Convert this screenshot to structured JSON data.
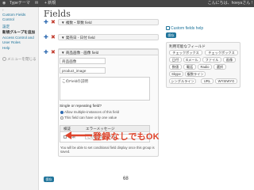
{
  "adminbar": {
    "site": "Typeテーマ",
    "comments": "0",
    "new": "+ 新規",
    "howdy": "こんにちは、hoeyaさん !"
  },
  "sidebar": {
    "items": [
      {
        "label": "Custom Fields"
      },
      {
        "label": "Control"
      },
      {
        "label": "設定"
      },
      {
        "label": "新規グループを追加"
      },
      {
        "label": "Access Control and"
      },
      {
        "label": "User Roles"
      },
      {
        "label": "Help"
      }
    ],
    "collapse": "メニューを閉じる"
  },
  "page": {
    "title": "Fields",
    "page_number": "68"
  },
  "fields": [
    {
      "label": "▼ 複数・単数 field"
    },
    {
      "label": "▼ 発売日 - 日付 field"
    },
    {
      "label": "▼ 商品画像 - 画像 field"
    }
  ],
  "edit_field": {
    "name_value": "商品画像",
    "slug_value": "product_image",
    "description_placeholder": "このFieldの説明",
    "repeat_title": "Single or repeating field?",
    "repeat_options": [
      {
        "label": "Allow multiple-instances of this field",
        "selected": true
      },
      {
        "label": "This field can have only one value",
        "selected": false
      }
    ],
    "validation": {
      "required_header": "検証",
      "error_header": "エラーメッセージ",
      "required_label": "必須",
      "error_message_value": "この項目は必須です"
    },
    "conditional_note": "You will be able to set conditional field display once this group is saved."
  },
  "annotation": "登録なしでもOK",
  "buttons": {
    "save": "保存",
    "help_save": "保存"
  },
  "right_panel": {
    "help_link": "Custom fields help",
    "types_title": "利用可能なフィールド",
    "types": [
      "チェックボックス",
      "チェックボックス",
      "日付",
      "Eメール",
      "ファイル",
      "画像",
      "数値",
      "電話",
      "Radio",
      "選択",
      "Skype",
      "複数ライン",
      "シングルライン",
      "URL",
      "WYSIWYG"
    ]
  },
  "colors": {
    "accent": "#21759b",
    "annotation": "#e0452c",
    "plus": "#2e6ab1",
    "delete": "#c0392b"
  }
}
